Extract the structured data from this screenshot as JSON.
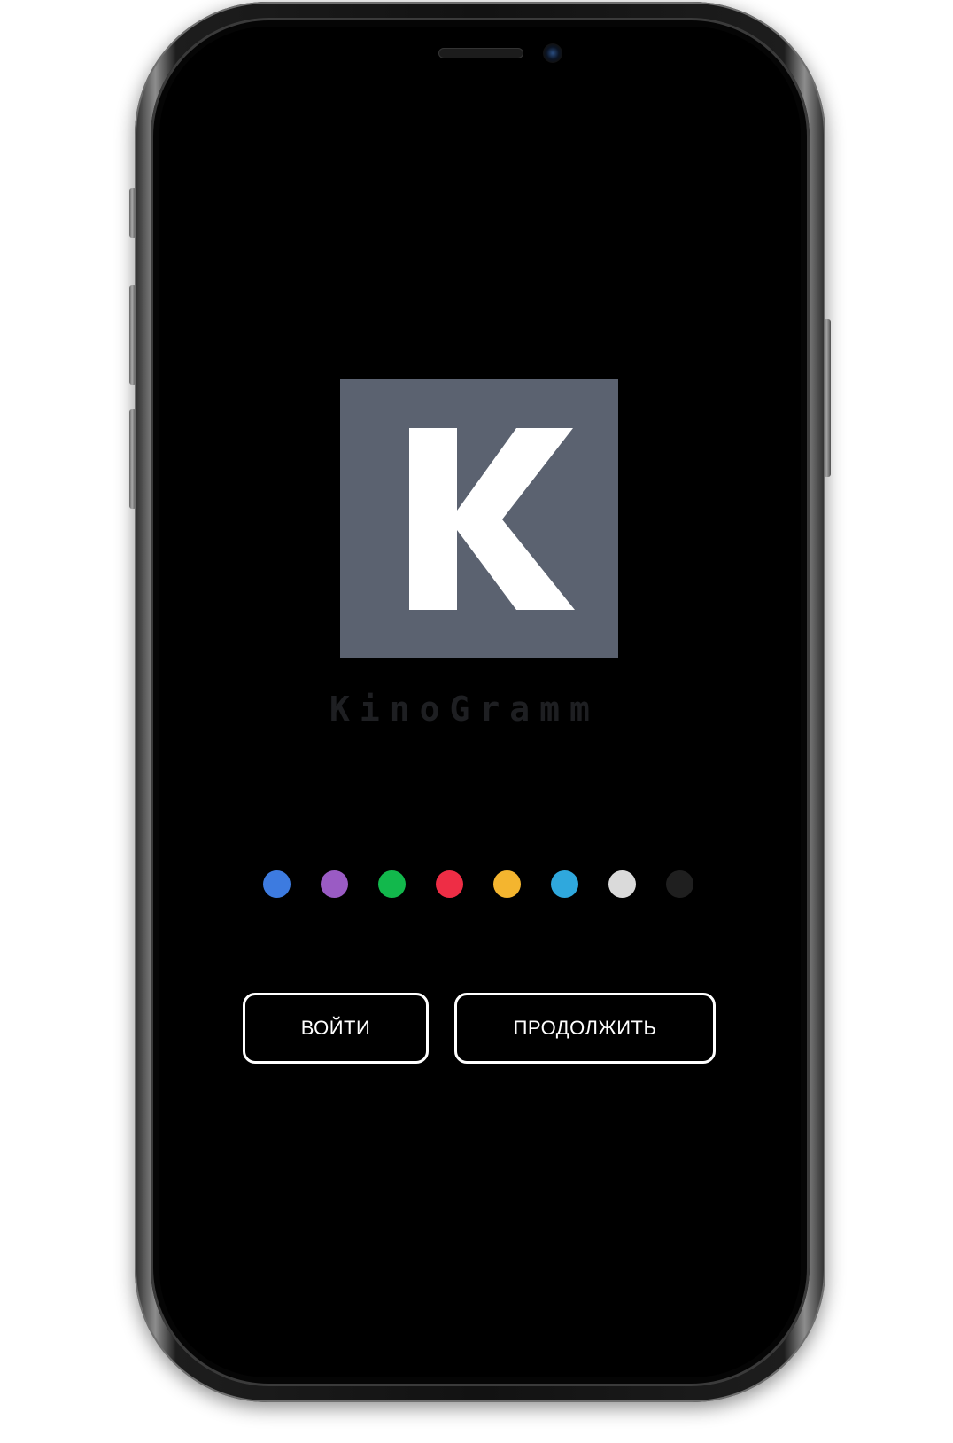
{
  "app": {
    "logo_letter": "K",
    "name": "KinoGramm"
  },
  "theme_dots": [
    {
      "name": "blue",
      "color": "#3d7be0"
    },
    {
      "name": "purple",
      "color": "#9a5bc4"
    },
    {
      "name": "green",
      "color": "#12b84c"
    },
    {
      "name": "red",
      "color": "#ee2d45"
    },
    {
      "name": "yellow",
      "color": "#f4b52f"
    },
    {
      "name": "cyan",
      "color": "#2fa8dd"
    },
    {
      "name": "light-gray",
      "color": "#dadada"
    },
    {
      "name": "dark-gray",
      "color": "#1f1f1f"
    }
  ],
  "actions": {
    "login_label": "ВОЙТИ",
    "continue_label": "ПРОДОЛЖИТЬ"
  },
  "colors": {
    "screen_background": "#000000",
    "logo_background": "#5b6270",
    "logo_letter": "#ffffff",
    "brand_text": "#1e1f22",
    "button_border": "#ffffff"
  }
}
